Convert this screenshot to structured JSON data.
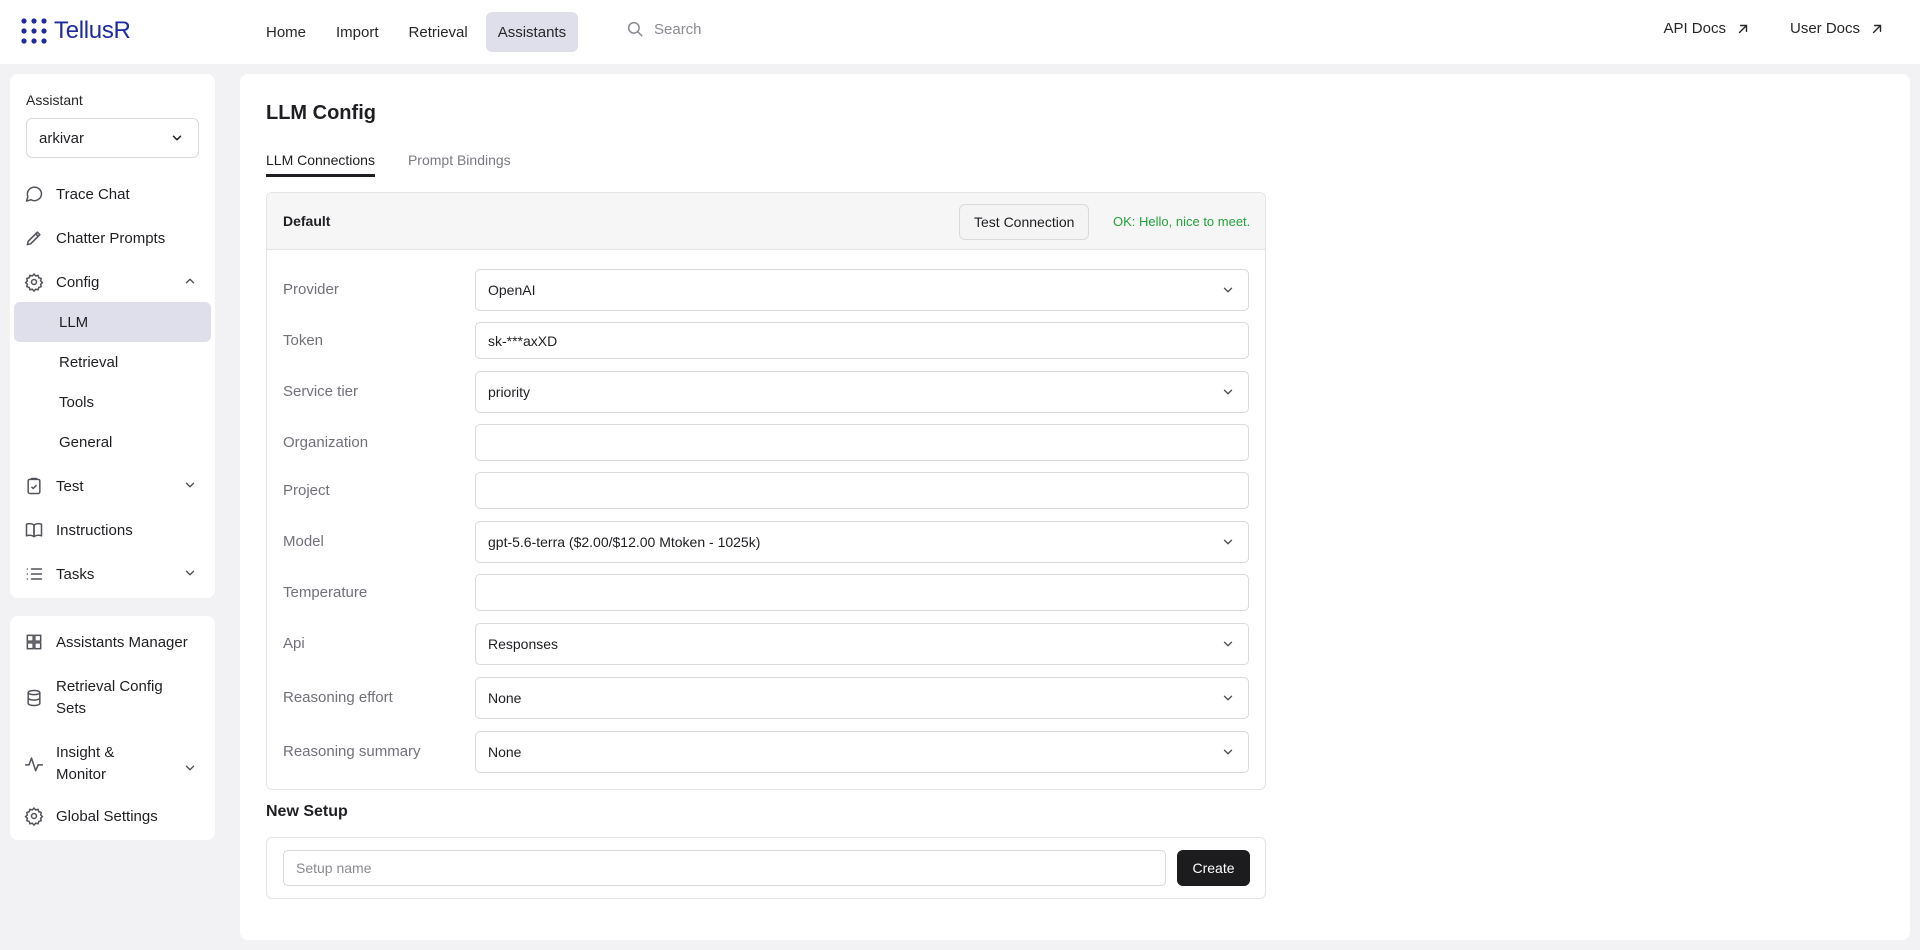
{
  "brand": {
    "name": "TellusR"
  },
  "nav": {
    "items": [
      "Home",
      "Import",
      "Retrieval",
      "Assistants"
    ],
    "active": "Assistants"
  },
  "search": {
    "placeholder": "Search"
  },
  "ext_links": [
    "API Docs",
    "User Docs"
  ],
  "sidebar": {
    "assistant_label": "Assistant",
    "assistant_value": "arkivar",
    "items": {
      "trace_chat": "Trace Chat",
      "chatter_prompts": "Chatter Prompts",
      "config": "Config",
      "config_sub": [
        "LLM",
        "Retrieval",
        "Tools",
        "General"
      ],
      "test": "Test",
      "instructions": "Instructions",
      "tasks": "Tasks"
    },
    "bottom": {
      "assistants_manager": "Assistants Manager",
      "retrieval_config_1": "Retrieval Config",
      "retrieval_config_2": "Sets",
      "insight_1": "Insight &",
      "insight_2": "Monitor",
      "global_settings": "Global Settings"
    }
  },
  "main": {
    "title": "LLM Config",
    "tabs": [
      "LLM Connections",
      "Prompt Bindings"
    ],
    "connection": {
      "name": "Default",
      "test_button": "Test Connection",
      "test_result": "OK: Hello, nice to meet.",
      "fields": {
        "provider": {
          "label": "Provider",
          "value": "OpenAI"
        },
        "token": {
          "label": "Token",
          "value": "sk-***axXD"
        },
        "service_tier": {
          "label": "Service tier",
          "value": "priority"
        },
        "organization": {
          "label": "Organization",
          "value": ""
        },
        "project": {
          "label": "Project",
          "value": ""
        },
        "model": {
          "label": "Model",
          "value": "gpt-5.6-terra ($2.00/$12.00 Mtoken - 1025k)"
        },
        "temperature": {
          "label": "Temperature",
          "value": ""
        },
        "api": {
          "label": "Api",
          "value": "Responses"
        },
        "reasoning_effort": {
          "label": "Reasoning effort",
          "value": "None"
        },
        "reasoning_summary": {
          "label": "Reasoning summary",
          "value": "None"
        }
      }
    },
    "new_setup": {
      "title": "New Setup",
      "placeholder": "Setup name",
      "create_button": "Create"
    }
  },
  "colors": {
    "brand": "#1d2b9c",
    "active_bg": "#dedfeb",
    "ok": "#22a33a",
    "primary_button": "#1c1c1f"
  },
  "icons": [
    "grid-dots-icon",
    "search-icon",
    "arrow-up-right-icon",
    "chevron-down-icon",
    "chevron-up-icon",
    "message-circle-icon",
    "pencil-icon",
    "gear-icon",
    "clipboard-check-icon",
    "book-open-icon",
    "list-icon",
    "layout-grid-icon",
    "database-icon",
    "activity-icon"
  ]
}
